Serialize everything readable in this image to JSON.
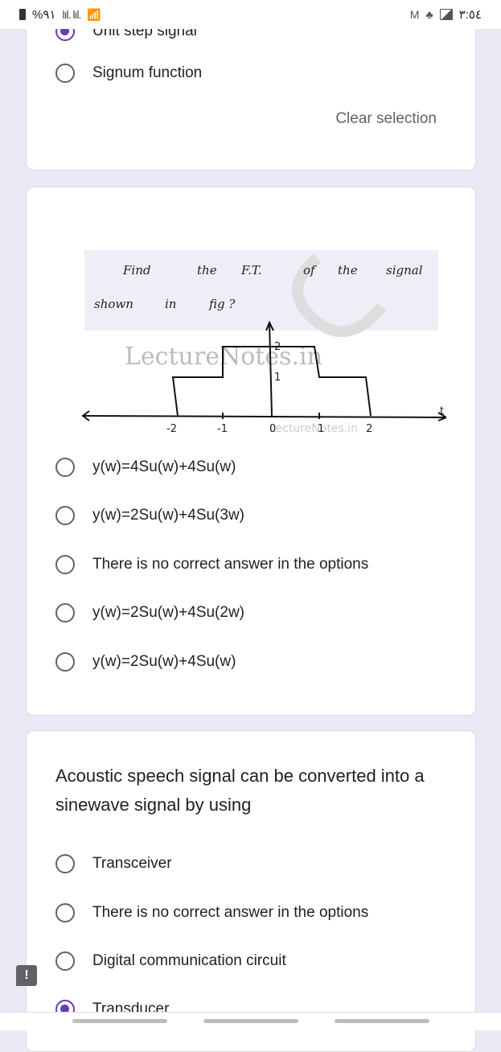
{
  "status_bar": {
    "battery": "%٩١",
    "signal_icons": "lıl. lıl.",
    "time": "٣:٥٤",
    "icons": [
      "battery-icon",
      "signal-icon",
      "signal-icon",
      "wifi-icon",
      "gmail-icon",
      "notification-icon",
      "image-icon"
    ]
  },
  "question1": {
    "options": [
      {
        "label": "Unit step signal",
        "selected": true
      },
      {
        "label": "Signum function",
        "selected": false
      }
    ],
    "clear_selection": "Clear selection"
  },
  "question2": {
    "image": {
      "text_line1": [
        "Find",
        "the",
        "F.T.",
        "of",
        "the",
        "signal"
      ],
      "text_line2": [
        "shown",
        "in",
        "fig ?"
      ],
      "watermark": "LectureNotes.in",
      "watermark_small": "LectureNotes.in",
      "axis_label": "t",
      "x_ticks": [
        "-2",
        "-1",
        "0",
        "1",
        "2"
      ],
      "y_ticks": [
        "1",
        "2"
      ]
    },
    "options": [
      {
        "label": "y(w)=4Su(w)+4Su(w)",
        "selected": false
      },
      {
        "label": "y(w)=2Su(w)+4Su(3w)",
        "selected": false
      },
      {
        "label": "There is no correct answer in the options",
        "selected": false
      },
      {
        "label": "y(w)=2Su(w)+4Su(2w)",
        "selected": false
      },
      {
        "label": "y(w)=2Su(w)+4Su(w)",
        "selected": false
      }
    ]
  },
  "question3": {
    "title": "Acoustic speech signal can be converted into a sinewave signal by using",
    "options": [
      {
        "label": "Transceiver",
        "selected": false
      },
      {
        "label": "There is no correct answer in the options",
        "selected": false
      },
      {
        "label": "Digital communication circuit",
        "selected": false
      },
      {
        "label": "Transducer",
        "selected": true
      }
    ]
  },
  "feedback": {
    "label": "!"
  },
  "colors": {
    "accent": "#673ab7",
    "background": "#ece8f6",
    "card": "#ffffff"
  }
}
